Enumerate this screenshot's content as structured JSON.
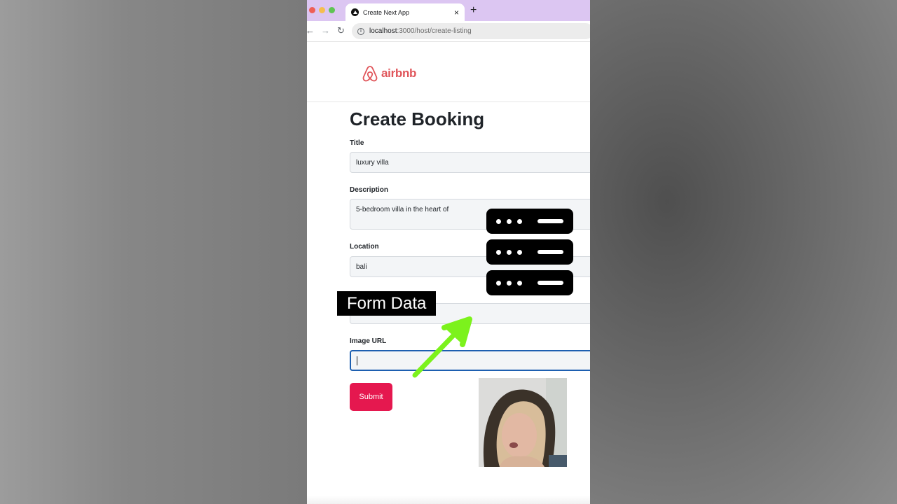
{
  "browser": {
    "tab_title": "Create Next App",
    "tab_close": "×",
    "new_tab": "+",
    "url_host": "localhost",
    "url_path": ":3000/host/create-listing",
    "back": "←",
    "forward": "→",
    "reload": "↻",
    "info_icon": "i"
  },
  "header": {
    "logo_text": "airbnb",
    "logo_color": "#e0565b"
  },
  "form": {
    "title": "Create Booking",
    "fields": [
      {
        "label": "Title",
        "value": "luxury villa"
      },
      {
        "label": "Description",
        "value": "5-bedroom villa in the heart of"
      },
      {
        "label": "Location",
        "value": "bali"
      },
      {
        "label": "",
        "value": ""
      },
      {
        "label": "Image URL",
        "value": ""
      }
    ],
    "submit_label": "Submit",
    "submit_color": "#e5184f"
  },
  "overlay": {
    "caption": "Form Data",
    "arrow_color": "#7cf21c",
    "server_icon": "server-stack-icon"
  }
}
